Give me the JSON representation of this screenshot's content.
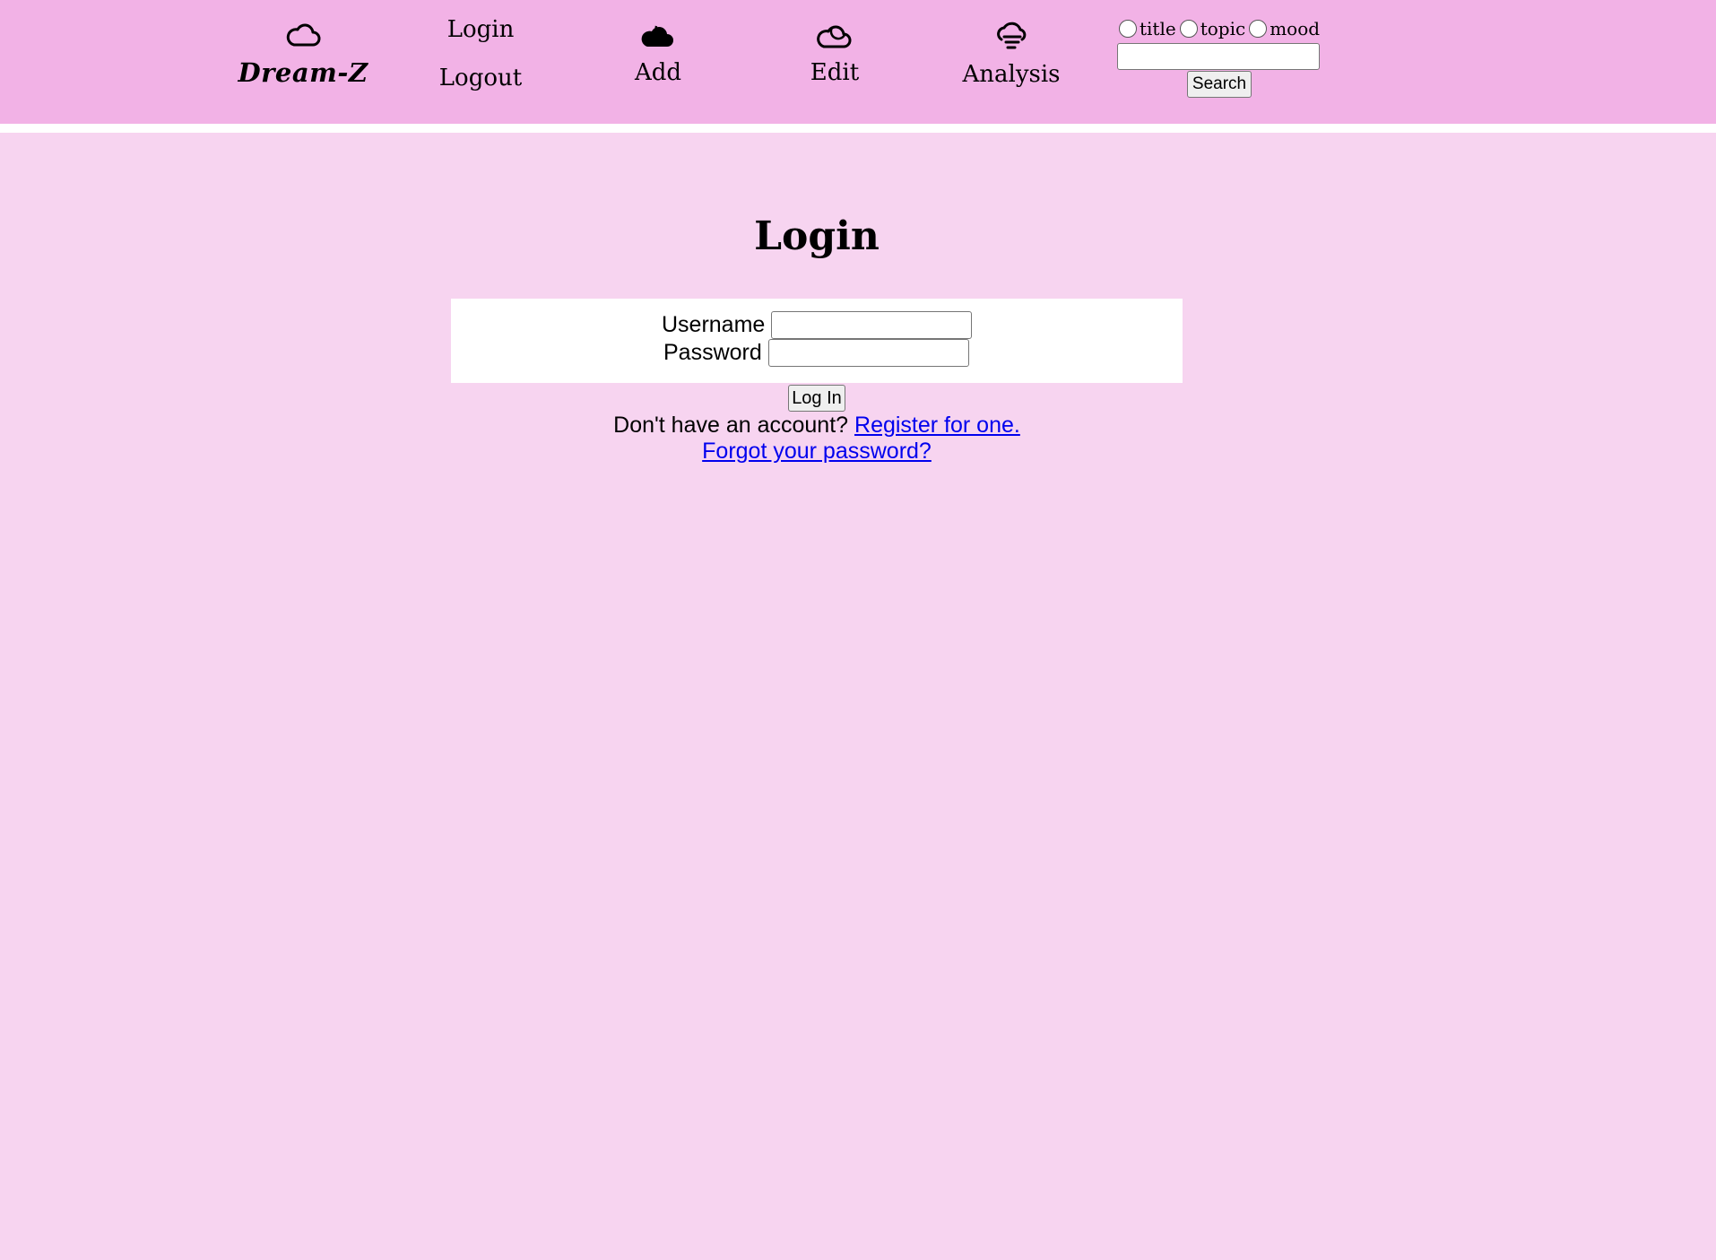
{
  "nav": {
    "brand": {
      "name": "Dream-Z",
      "icon": "cloud-icon"
    },
    "auth": {
      "login_label": "Login",
      "logout_label": "Logout"
    },
    "add": {
      "label": "Add",
      "icon": "cloud-moon-icon"
    },
    "edit": {
      "label": "Edit",
      "icon": "cloud-moon-outline-icon"
    },
    "analysis": {
      "label": "Analysis",
      "icon": "cloud-fog-icon"
    },
    "search": {
      "radios": [
        "title",
        "topic",
        "mood"
      ],
      "input_value": "",
      "button_label": "Search"
    }
  },
  "main": {
    "title": "Login",
    "form": {
      "username_label": "Username",
      "username_value": "",
      "password_label": "Password",
      "password_value": "",
      "submit_label": "Log In"
    },
    "register_prompt": "Don't have an account?",
    "register_link": "Register for one.",
    "forgot_link": "Forgot your password?"
  },
  "colors": {
    "navbar": "#f2b2e6",
    "page_background": "#f7d4f0",
    "card": "#ffffff",
    "link": "#0000ee"
  }
}
